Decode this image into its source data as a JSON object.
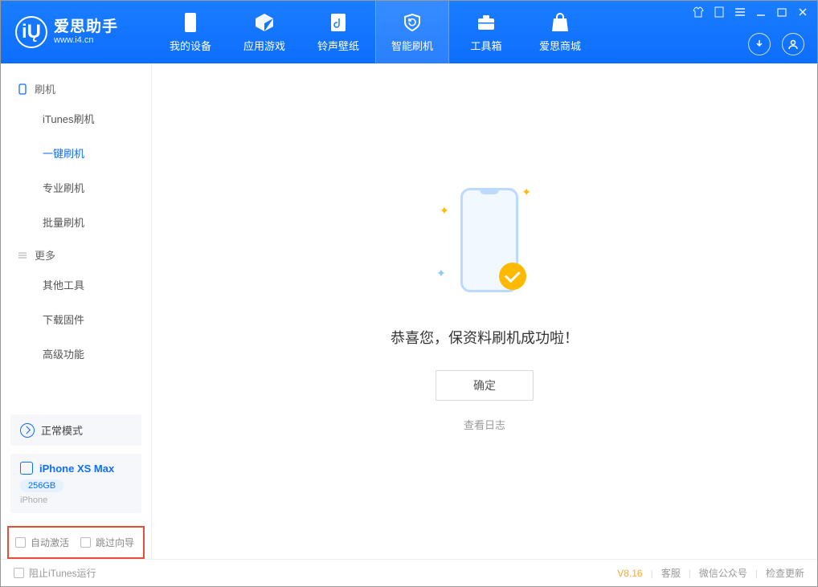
{
  "app": {
    "title": "爱思助手",
    "url": "www.i4.cn"
  },
  "tabs": {
    "device": "我的设备",
    "apps": "应用游戏",
    "ringtone": "铃声壁纸",
    "flash": "智能刷机",
    "toolbox": "工具箱",
    "store": "爱思商城"
  },
  "sidebar": {
    "group_flash": "刷机",
    "itunes": "iTunes刷机",
    "oneclick": "一键刷机",
    "pro": "专业刷机",
    "batch": "批量刷机",
    "group_more": "更多",
    "other": "其他工具",
    "firmware": "下载固件",
    "advanced": "高级功能"
  },
  "mode": {
    "label": "正常模式"
  },
  "device": {
    "name": "iPhone XS Max",
    "storage": "256GB",
    "type": "iPhone"
  },
  "checks": {
    "auto_activate": "自动激活",
    "skip_guide": "跳过向导"
  },
  "success": {
    "title": "恭喜您，保资料刷机成功啦！",
    "ok": "确定",
    "view_log": "查看日志"
  },
  "footer": {
    "block_itunes": "阻止iTunes运行",
    "version": "V8.16",
    "support": "客服",
    "wechat": "微信公众号",
    "update": "检查更新"
  }
}
